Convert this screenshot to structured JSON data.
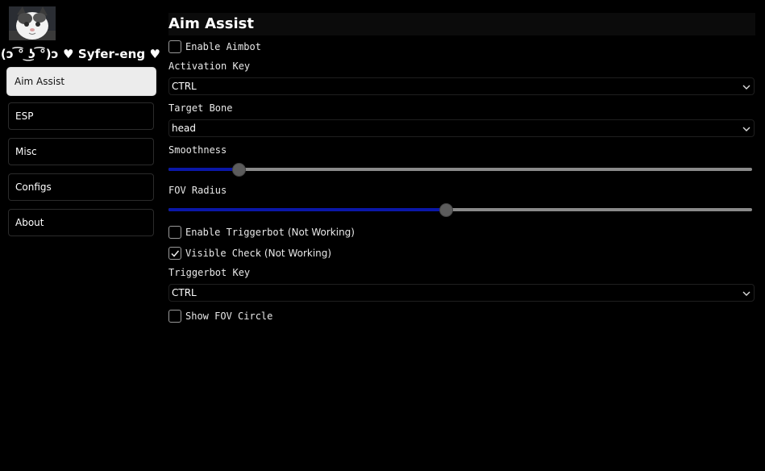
{
  "sidebar": {
    "brand": "(ↄ ͡° ͜ʖ ͡°)ↄ ♥ Syfer-eng ♥",
    "items": [
      {
        "label": "Aim Assist",
        "active": true
      },
      {
        "label": "ESP",
        "active": false
      },
      {
        "label": "Misc",
        "active": false
      },
      {
        "label": "Configs",
        "active": false
      },
      {
        "label": "About",
        "active": false
      }
    ]
  },
  "main": {
    "title": "Aim Assist",
    "enable_aimbot": {
      "label": "Enable Aimbot",
      "checked": false
    },
    "activation_key": {
      "label": "Activation Key",
      "value": "CTRL"
    },
    "target_bone": {
      "label": "Target Bone",
      "value": "head"
    },
    "smoothness": {
      "label": "Smoothness",
      "fraction": 0.12
    },
    "fov_radius": {
      "label": "FOV Radius",
      "fraction": 0.475
    },
    "enable_triggerbot": {
      "label_mono": "Enable Triggerbot",
      "label_sans": "(Not Working)",
      "checked": false
    },
    "visible_check": {
      "label_mono": "Visible Check",
      "label_sans": "(Not Working)",
      "checked": true
    },
    "triggerbot_key": {
      "label": "Triggerbot Key",
      "value": "CTRL"
    },
    "show_fov_circle": {
      "label": "Show FOV Circle",
      "checked": false
    }
  },
  "colors": {
    "background": "#000000",
    "active_nav": "#ececec",
    "slider_fill": "#0a17a8",
    "slider_track": "#8a8a8a"
  },
  "icons": [
    "avatar-cat",
    "chevron-down-icon",
    "checkmark-icon"
  ]
}
